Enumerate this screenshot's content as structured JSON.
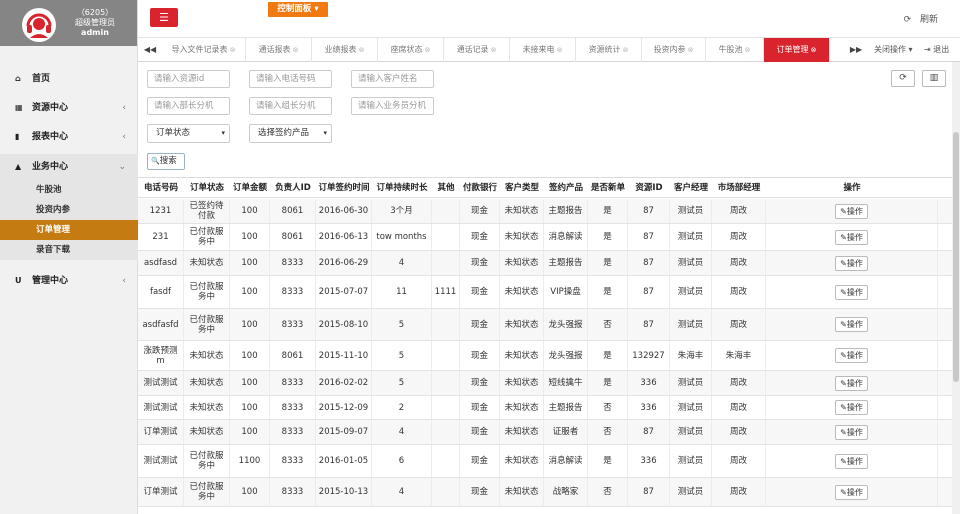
{
  "sidebar": {
    "user_id": "（6205）",
    "role": "超级管理员",
    "username": "admin",
    "nav": [
      {
        "label": "首页",
        "icon": "home-icon",
        "glyph": "⌂"
      },
      {
        "label": "资源中心",
        "icon": "grid-icon",
        "glyph": "▦",
        "chevron": "‹"
      },
      {
        "label": "报表中心",
        "icon": "chart-icon",
        "glyph": "▮",
        "chevron": "‹"
      },
      {
        "label": "业务中心",
        "icon": "graduation-cap-icon",
        "glyph": "▲",
        "chevron": "⌄"
      },
      {
        "label": "管理中心",
        "icon": "magnet-icon",
        "glyph": "U",
        "chevron": "‹"
      }
    ],
    "sub_items": [
      {
        "label": "牛股池",
        "active": false
      },
      {
        "label": "投资内参",
        "active": false
      },
      {
        "label": "订单管理",
        "active": true
      },
      {
        "label": "录音下载",
        "active": false
      }
    ]
  },
  "topbar": {
    "menu_glyph": "☰",
    "control_panel": "控制面板 ▾",
    "refresh": "刷新",
    "refresh_glyph": "⟳"
  },
  "tabs": {
    "prev": "◀◀",
    "next": "▶▶",
    "items": [
      {
        "label": "导入文件记录表",
        "active": false
      },
      {
        "label": "通话报表",
        "active": false
      },
      {
        "label": "业绩报表",
        "active": false
      },
      {
        "label": "座席状态",
        "active": false
      },
      {
        "label": "通话记录",
        "active": false
      },
      {
        "label": "未接来电",
        "active": false
      },
      {
        "label": "资源统计",
        "active": false
      },
      {
        "label": "投资内参",
        "active": false
      },
      {
        "label": "牛股池",
        "active": false
      },
      {
        "label": "订单管理",
        "active": true
      }
    ],
    "close_glyph": "⊗",
    "close_ops": "关闭操作 ▾",
    "logout": "⇥ 退出"
  },
  "filters": {
    "placeholders": [
      "请输入资源id",
      "请输入电话号码",
      "请输入客户姓名",
      "请输入部长分机",
      "请输入组长分机",
      "请输入业务员分机"
    ],
    "order_status": "订单状态",
    "product": "选择签约产品",
    "caret": "▾",
    "search": "搜索",
    "search_glyph": "🔍",
    "tool_refresh": "⟳",
    "tool_columns": "▥"
  },
  "table": {
    "headers": [
      "电话号码",
      "订单状态",
      "订单金额",
      "负责人ID",
      "订单签约时间",
      "订单持续时长",
      "其他",
      "付款银行",
      "客户类型",
      "签约产品",
      "是否新单",
      "资源ID",
      "客户经理",
      "市场部经理",
      "操作"
    ],
    "op_label": "操作",
    "op_glyph": "✎",
    "rows": [
      [
        "1231",
        "已签约待付款",
        "100",
        "8061",
        "2016-06-30",
        "3个月",
        "",
        "现金",
        "未知状态",
        "主题报告",
        "是",
        "87",
        "测试员",
        "周改"
      ],
      [
        "231",
        "已付款服务中",
        "100",
        "8061",
        "2016-06-13",
        "tow months",
        "",
        "现金",
        "未知状态",
        "消息解读",
        "是",
        "87",
        "测试员",
        "周改"
      ],
      [
        "asdfasd",
        "未知状态",
        "100",
        "8333",
        "2016-06-29",
        "4",
        "",
        "现金",
        "未知状态",
        "主题报告",
        "是",
        "87",
        "测试员",
        "周改"
      ],
      [
        "fasdf",
        "已付款服务中",
        "100",
        "8333",
        "2015-07-07",
        "11",
        "1111",
        "现金",
        "未知状态",
        "VIP操盘",
        "是",
        "87",
        "测试员",
        "周改"
      ],
      [
        "asdfasfd",
        "已付款服务中",
        "100",
        "8333",
        "2015-08-10",
        "5",
        "",
        "现金",
        "未知状态",
        "龙头强报",
        "否",
        "87",
        "测试员",
        "周改"
      ],
      [
        "涨跌预测m",
        "未知状态",
        "100",
        "8061",
        "2015-11-10",
        "5",
        "",
        "现金",
        "未知状态",
        "龙头强报",
        "是",
        "132927",
        "朱海丰",
        "朱海丰"
      ],
      [
        "测试测试",
        "未知状态",
        "100",
        "8333",
        "2016-02-02",
        "5",
        "",
        "现金",
        "未知状态",
        "短线擒牛",
        "是",
        "336",
        "测试员",
        "周改"
      ],
      [
        "测试测试",
        "未知状态",
        "100",
        "8333",
        "2015-12-09",
        "2",
        "",
        "现金",
        "未知状态",
        "主题报告",
        "否",
        "336",
        "测试员",
        "周改"
      ],
      [
        "订单测试",
        "未知状态",
        "100",
        "8333",
        "2015-09-07",
        "4",
        "",
        "现金",
        "未知状态",
        "证服者",
        "否",
        "87",
        "测试员",
        "周改"
      ],
      [
        "测试测试",
        "已付款服务中",
        "1100",
        "8333",
        "2016-01-05",
        "6",
        "",
        "现金",
        "未知状态",
        "消息解读",
        "是",
        "336",
        "测试员",
        "周改"
      ],
      [
        "订单测试",
        "已付款服务中",
        "100",
        "8333",
        "2015-10-13",
        "4",
        "",
        "现金",
        "未知状态",
        "战略家",
        "否",
        "87",
        "测试员",
        "周改"
      ]
    ]
  },
  "colors": {
    "accent": "#d9242d",
    "sidebar_active": "#c37b12",
    "control_panel": "#f07a10"
  }
}
